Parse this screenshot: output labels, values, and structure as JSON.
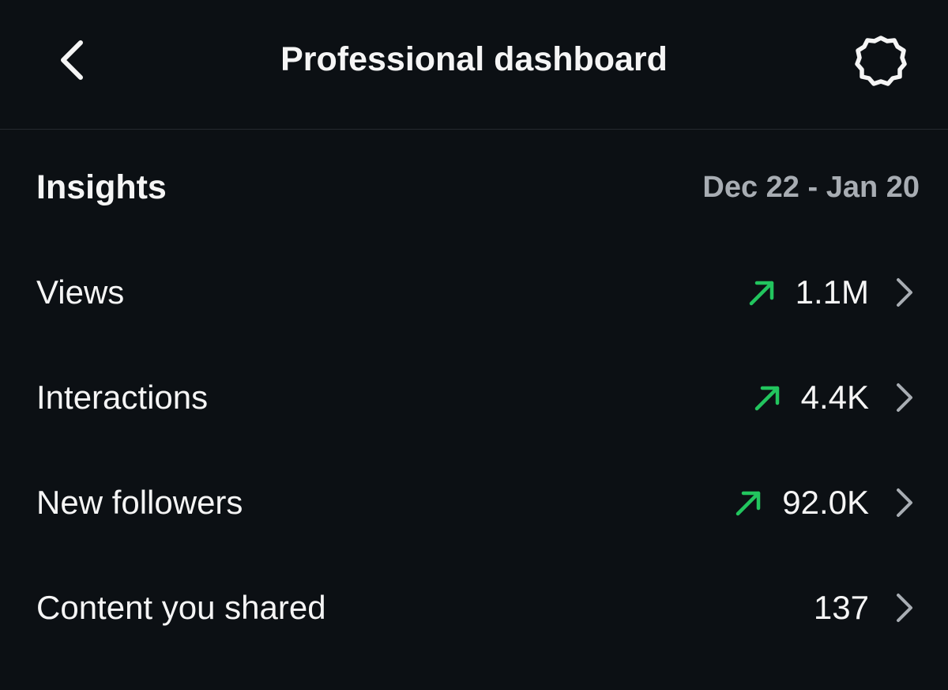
{
  "header": {
    "title": "Professional dashboard",
    "back_icon": "chevron-left-icon",
    "settings_icon": "gear-icon"
  },
  "insights": {
    "title": "Insights",
    "date_range": "Dec 22 - Jan 20"
  },
  "metrics": [
    {
      "label": "Views",
      "value": "1.1M",
      "trend": "up"
    },
    {
      "label": "Interactions",
      "value": "4.4K",
      "trend": "up"
    },
    {
      "label": "New followers",
      "value": "92.0K",
      "trend": "up"
    },
    {
      "label": "Content you shared",
      "value": "137",
      "trend": "none"
    }
  ],
  "colors": {
    "background": "#0c1014",
    "text_primary": "#f5f5f5",
    "text_secondary": "#a8adb3",
    "trend_up": "#22c55e",
    "divider": "#262a2f"
  }
}
